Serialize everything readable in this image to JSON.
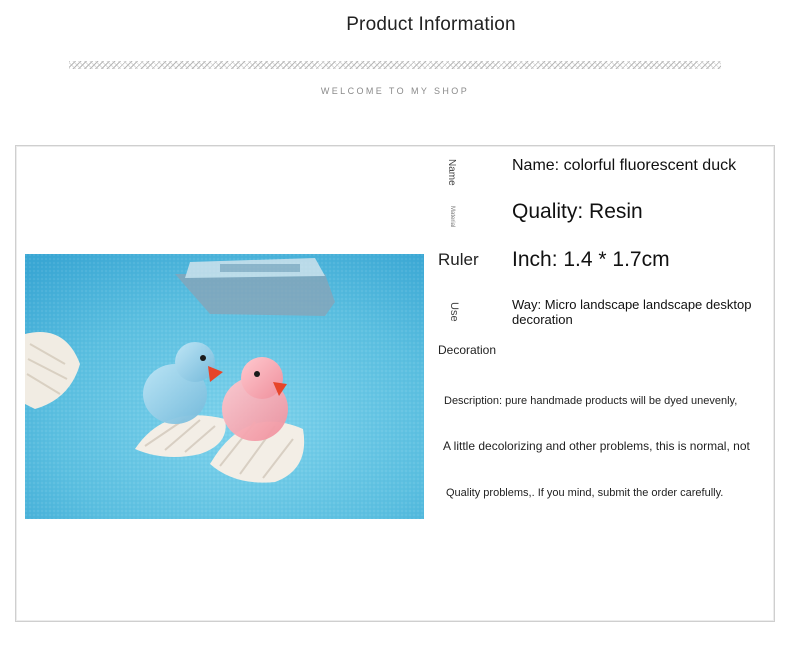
{
  "header": {
    "title": "Product Information",
    "subtitle": "WELCOME TO MY SHOP"
  },
  "labels": {
    "name": "Name",
    "material": "Material",
    "ruler": "Ruler",
    "use": "Use",
    "decoration": "Decoration"
  },
  "values": {
    "name": "Name: colorful fluorescent duck",
    "quality": "Quality: Resin",
    "inch": "Inch: 1.4 * 1.7cm",
    "way": "Way: Micro landscape landscape desktop decoration"
  },
  "description": {
    "line1": "Description: pure handmade products will be dyed unevenly,",
    "line2": "A little decolorizing and other problems, this is normal, not",
    "line3": "Quality problems,. If you mind, submit the order carefully."
  },
  "colors": {
    "sand": "#63c6e4",
    "blue_duck": "#8fcbe6",
    "pink_duck": "#f5a7b2",
    "beak": "#e7452a",
    "shell": "#f3eee6"
  },
  "icons": {
    "zigzag_divider": "zigzag-line"
  }
}
